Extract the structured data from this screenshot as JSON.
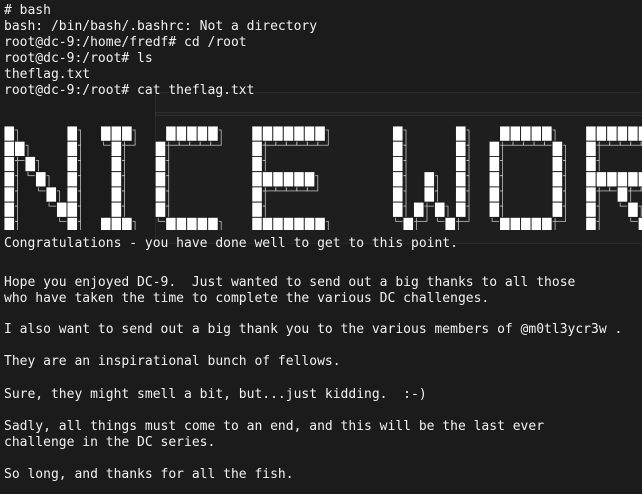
{
  "terminal": {
    "lines": [
      "# bash",
      "bash: /bin/bash/.bashrc: Not a directory",
      "root@dc-9:/home/fredf# cd /root",
      "root@dc-9:/root# ls",
      "theflag.txt",
      "root@dc-9:/root# cat theflag.txt"
    ],
    "banner_text": "NICE WORK!!!",
    "message": [
      "Congratulations - you have done well to get to this point.",
      "Hope you enjoyed DC-9.  Just wanted to send out a big thanks to all those",
      "who have taken the time to complete the various DC challenges.",
      "I also want to send out a big thank you to the various members of @m0tl3ycr3w .",
      "They are an inspirational bunch of fellows.",
      "Sure, they might smell a bit, but...just kidding.  :-)",
      "Sadly, all things must come to an end, and this will be the last ever",
      "challenge in the DC series.",
      "So long, and thanks for all the fish."
    ]
  },
  "colors": {
    "background": "#1b1b1b",
    "text": "#f2f2f2",
    "banner_fill": "#ffffff"
  }
}
